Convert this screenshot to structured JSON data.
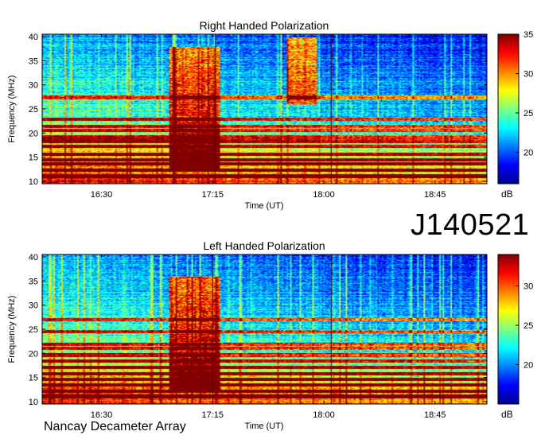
{
  "observation_id": "J140521",
  "observatory": "Nancay Decameter Array",
  "colors": {
    "low": "#00008f",
    "mid": "#7fff7f",
    "high": "#7f0000"
  },
  "chart_data": [
    {
      "type": "heatmap",
      "title": "Right Handed Polarization",
      "xlabel": "Time (UT)",
      "ylabel": "Frequency (MHz)",
      "xticks": [
        "16:30",
        "17:15",
        "18:00",
        "18:45"
      ],
      "xtick_hours": [
        16.5,
        17.25,
        18.0,
        18.75
      ],
      "xlim_hours": [
        16.1,
        19.1
      ],
      "yticks": [
        10,
        15,
        20,
        25,
        30,
        35,
        40
      ],
      "ylim": [
        9.5,
        40.5
      ],
      "colorbar": {
        "label": "dB",
        "ticks": [
          20,
          25,
          30,
          35
        ],
        "range": [
          16,
          35
        ]
      },
      "colormap": "jet",
      "strong_bands_mhz": [
        11,
        12.2,
        13.5,
        14.4,
        15.6,
        17.2,
        18.3,
        19.1,
        20.5,
        21.3,
        22.8,
        27.4
      ],
      "features": [
        {
          "kind": "burst",
          "start": 16.95,
          "end": 17.3,
          "fmin": 12,
          "fmax": 38
        },
        {
          "kind": "burst",
          "start": 17.75,
          "end": 17.95,
          "fmin": 26,
          "fmax": 40
        },
        {
          "kind": "vertical_line",
          "time": 17.27
        },
        {
          "kind": "vertical_line",
          "time": 18.05
        }
      ]
    },
    {
      "type": "heatmap",
      "title": "Left Handed Polarization",
      "xlabel": "Time (UT)",
      "ylabel": "Frequency (MHz)",
      "xticks": [
        "16:30",
        "17:15",
        "18:00",
        "18:45"
      ],
      "xtick_hours": [
        16.5,
        17.25,
        18.0,
        18.75
      ],
      "xlim_hours": [
        16.1,
        19.1
      ],
      "yticks": [
        10,
        15,
        20,
        25,
        30,
        35,
        40
      ],
      "ylim": [
        9.5,
        40.5
      ],
      "colorbar": {
        "label": "dB",
        "ticks": [
          20,
          25,
          30
        ],
        "range": [
          15,
          34
        ]
      },
      "colormap": "jet",
      "strong_bands_mhz": [
        11,
        12.1,
        13.4,
        14.6,
        15.7,
        17.1,
        18.4,
        19.6,
        21.0,
        21.8,
        24.5,
        27.0
      ],
      "features": [
        {
          "kind": "burst",
          "start": 16.95,
          "end": 17.3,
          "fmin": 12,
          "fmax": 36
        },
        {
          "kind": "vertical_line",
          "time": 17.25
        },
        {
          "kind": "vertical_line",
          "time": 18.05
        }
      ]
    }
  ]
}
